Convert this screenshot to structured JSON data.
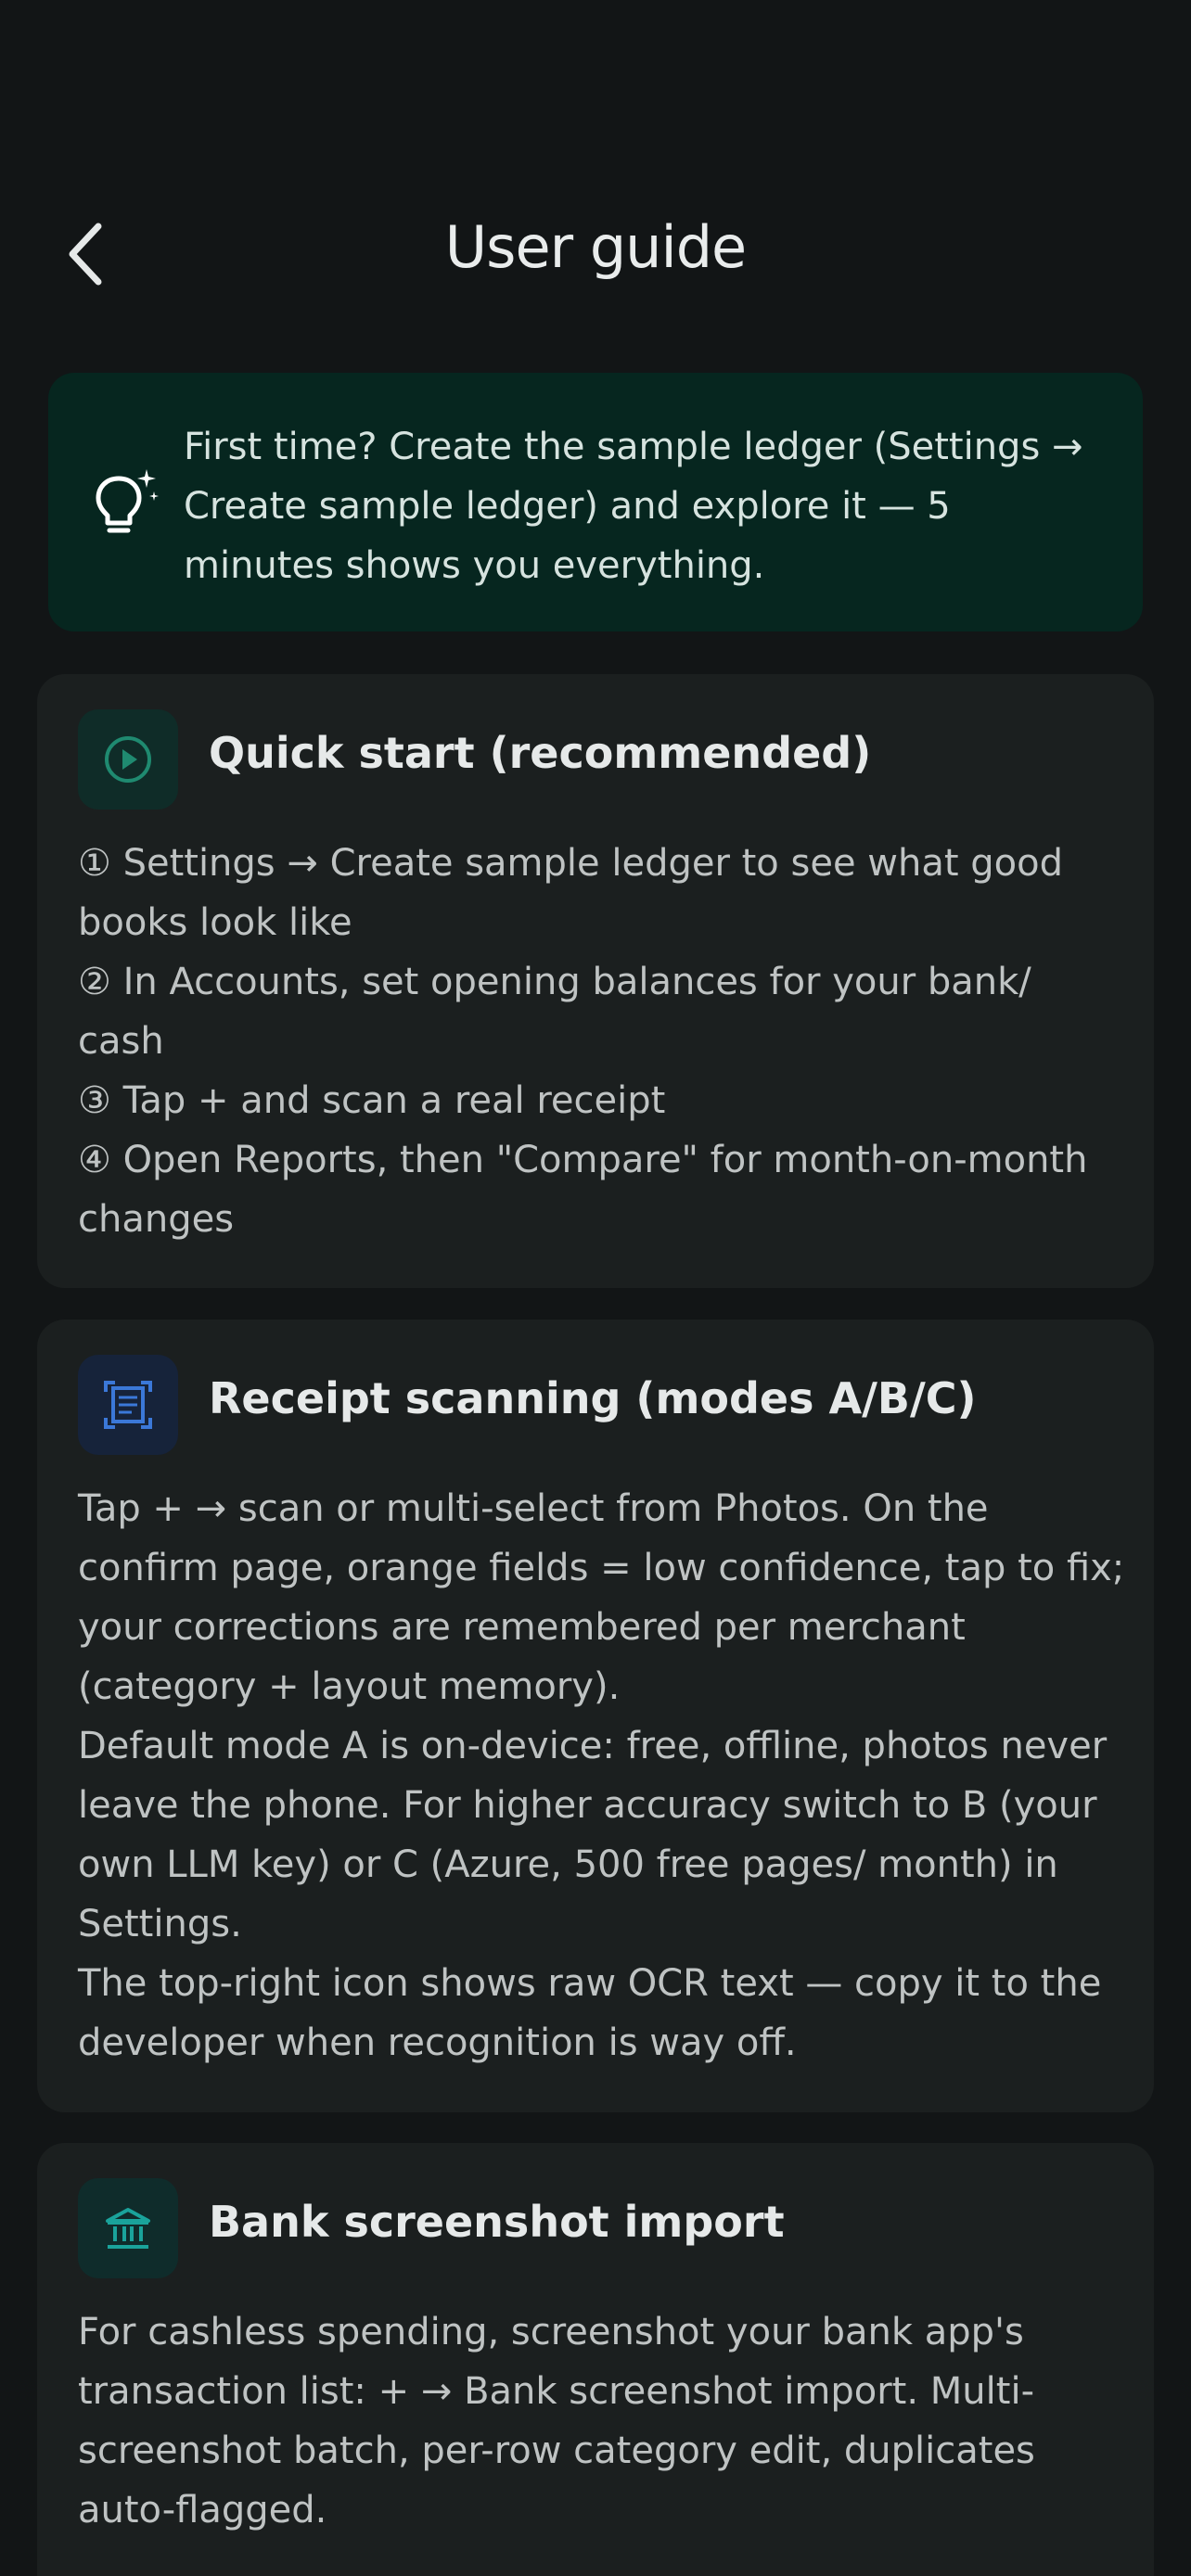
{
  "header": {
    "title": "User guide",
    "back_icon": "chevron-left-icon"
  },
  "tip": {
    "icon": "lightbulb-sparkle-icon",
    "text": "First time? Create the sample ledger (Settings → Create sample ledger) and explore it — 5 minutes shows you everything."
  },
  "sections": [
    {
      "icon": "play-circle-icon",
      "title": "Quick start (recommended)",
      "lines": [
        "① Settings → Create sample ledger to see what good books look like",
        "② In Accounts, set opening balances for your bank/ cash",
        "③ Tap + and scan a real receipt",
        "④ Open Reports, then \"Compare\" for month-on-month changes"
      ]
    },
    {
      "icon": "document-scan-icon",
      "title": "Receipt scanning (modes A/B/C)",
      "lines": [
        "Tap + → scan or multi-select from Photos. On the confirm page, orange fields = low confidence, tap to fix; your corrections are remembered per merchant (category + layout memory).",
        "Default mode A is on-device: free, offline, photos never leave the phone. For higher accuracy switch to B (your own LLM key) or C (Azure, 500 free pages/ month) in Settings.",
        "The top-right icon shows raw OCR text — copy it to the developer when recognition is way off."
      ]
    },
    {
      "icon": "bank-icon",
      "title": "Bank screenshot import",
      "lines": [
        "For cashless spending, screenshot your bank app's transaction list: + → Bank screenshot import. Multi-screenshot batch, per-row category edit, duplicates auto-flagged."
      ]
    }
  ],
  "colors": {
    "background": "#121516",
    "card": "#1b1f1f",
    "tip_background": "#06261f",
    "accent_green": "#1f8a70",
    "accent_blue": "#3b78d8",
    "accent_teal": "#1aa39b"
  }
}
